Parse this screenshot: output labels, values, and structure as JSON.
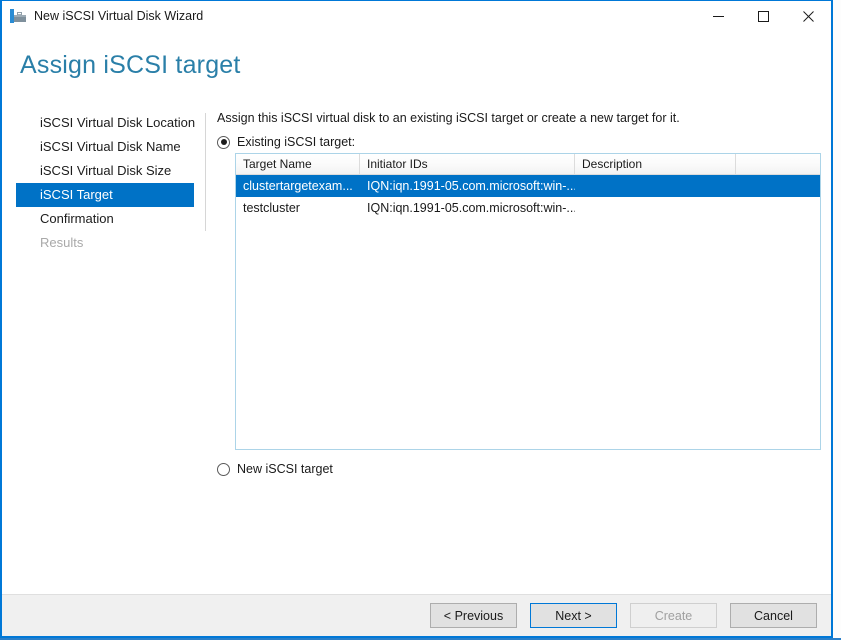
{
  "window": {
    "title": "New iSCSI Virtual Disk Wizard",
    "icon": "iscsi-wizard-icon",
    "controls": {
      "minimize": "—",
      "maximize": "☐",
      "close": "✕"
    },
    "accent_color": "#0078d7"
  },
  "page": {
    "heading": "Assign iSCSI target",
    "heading_color": "#2a7fa8"
  },
  "sidebar": {
    "items": [
      {
        "label": "iSCSI Virtual Disk Location",
        "state": "normal"
      },
      {
        "label": "iSCSI Virtual Disk Name",
        "state": "normal"
      },
      {
        "label": "iSCSI Virtual Disk Size",
        "state": "normal"
      },
      {
        "label": "iSCSI Target",
        "state": "selected"
      },
      {
        "label": "Confirmation",
        "state": "normal"
      },
      {
        "label": "Results",
        "state": "disabled"
      }
    ],
    "selected_color": "#0072c6"
  },
  "main": {
    "intro": "Assign this iSCSI virtual disk to an existing iSCSI target or create a new target for it.",
    "existing_target_radio": {
      "label": "Existing iSCSI target:",
      "checked": true
    },
    "new_target_radio": {
      "label": "New iSCSI target",
      "checked": false
    },
    "target_list": {
      "columns": [
        "Target Name",
        "Initiator IDs",
        "Description",
        ""
      ],
      "rows": [
        {
          "target_name": "clustertargetexam...",
          "initiator_ids": "IQN:iqn.1991-05.com.microsoft:win-...",
          "description": "",
          "extra": "",
          "selected": true
        },
        {
          "target_name": "testcluster",
          "initiator_ids": "IQN:iqn.1991-05.com.microsoft:win-...",
          "description": "",
          "extra": "",
          "selected": false
        }
      ]
    }
  },
  "footer": {
    "previous_label": "< Previous",
    "next_label": "Next >",
    "create_label": "Create",
    "cancel_label": "Cancel",
    "create_enabled": false,
    "next_is_default": true
  }
}
